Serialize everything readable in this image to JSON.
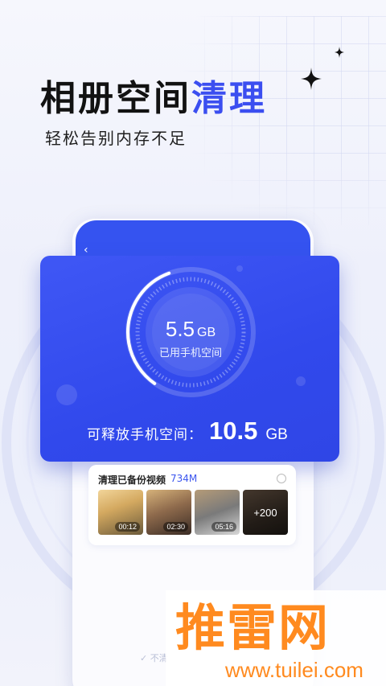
{
  "header": {
    "title_main": "相册空间",
    "title_highlight": "清理",
    "subtitle": "轻松告别内存不足"
  },
  "gauge": {
    "used_value": "5.5",
    "used_unit": "GB",
    "used_label": "已用手机空间"
  },
  "free_space": {
    "label": "可释放手机空间：",
    "value": "10.5",
    "unit": "GB"
  },
  "backup_videos": {
    "title": "清理已备份视频",
    "size": "734M",
    "thumbnails": [
      {
        "duration": "00:12"
      },
      {
        "duration": "02:30"
      },
      {
        "duration": "05:16"
      },
      {
        "more": "+200"
      }
    ]
  },
  "footer": {
    "partial_text": "不清"
  },
  "watermark": {
    "logo_text": "推雷网",
    "url": "www.tuilei.com"
  },
  "colors": {
    "accent": "#3b4ef0",
    "card": "#3551f0",
    "watermark": "#ff8a1f"
  }
}
